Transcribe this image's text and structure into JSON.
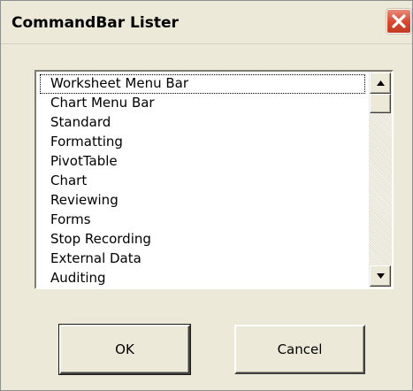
{
  "window": {
    "title": "CommandBar Lister"
  },
  "listbox": {
    "items": [
      "Worksheet Menu Bar",
      "Chart Menu Bar",
      "Standard",
      "Formatting",
      "PivotTable",
      "Chart",
      "Reviewing",
      "Forms",
      "Stop Recording",
      "External Data",
      "Auditing"
    ],
    "focused_index": 0
  },
  "buttons": {
    "ok_label": "OK",
    "cancel_label": "Cancel"
  },
  "icons": {
    "close": "close-icon",
    "scroll_up": "up-arrow-icon",
    "scroll_down": "down-arrow-icon"
  },
  "colors": {
    "dialog_bg": "#ece9d8",
    "close_button": "#d9462d",
    "list_bg": "#ffffff"
  }
}
